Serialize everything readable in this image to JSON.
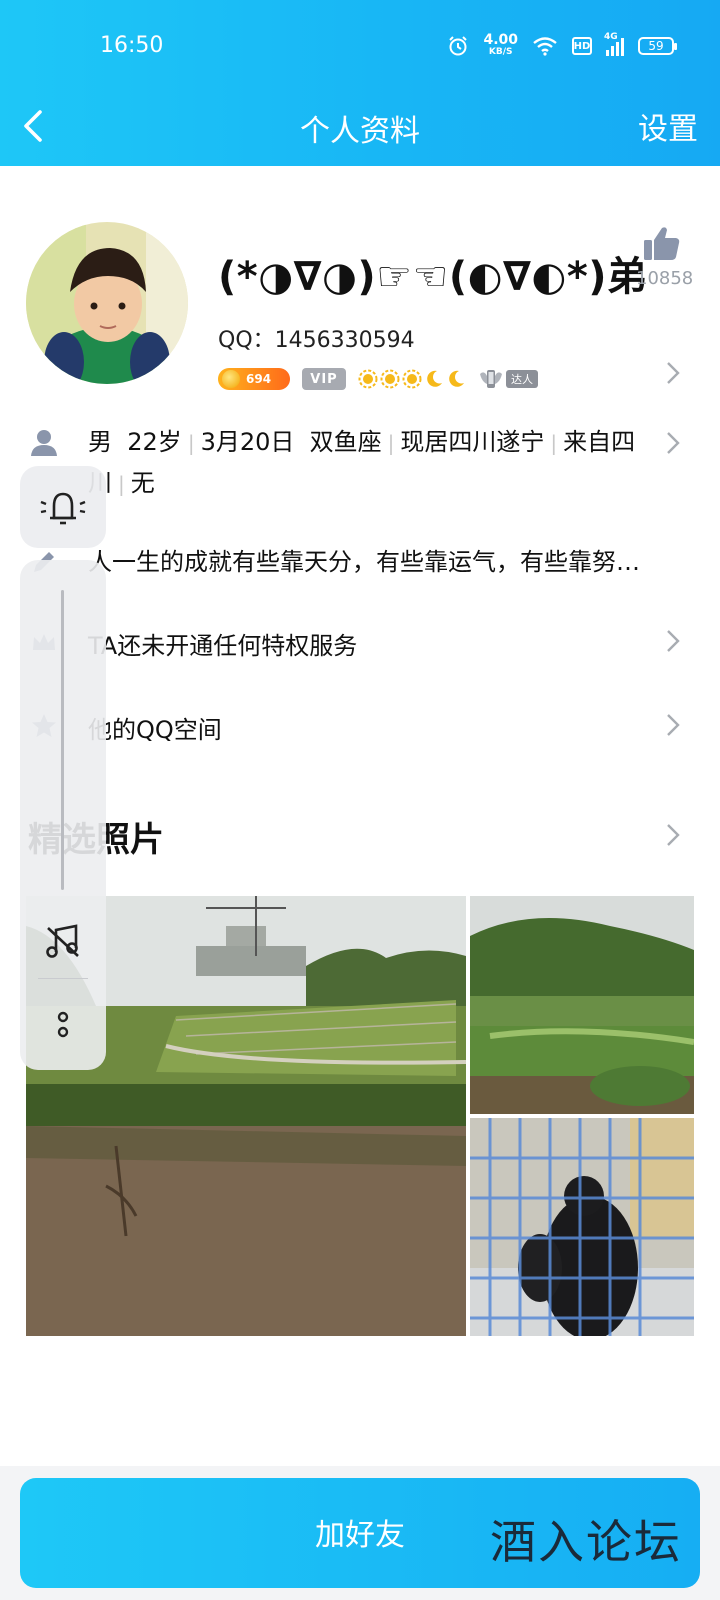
{
  "status_bar": {
    "time": "16:50",
    "speed_value": "4.00",
    "speed_unit": "KB/S",
    "hd": "HD",
    "network": "4G",
    "battery": "59"
  },
  "nav": {
    "back_icon": "chevron-left-icon",
    "title": "个人资料",
    "settings": "设置"
  },
  "profile": {
    "nickname": "(*◑∇◑)☞☜(◐∇◐*)弟",
    "qq_label": "QQ：",
    "qq_number": "1456330594",
    "level_value": "694",
    "vip_label": "VIP",
    "daren_label": "达人",
    "like_count": "10858"
  },
  "info": {
    "gender": "男",
    "age": "22岁",
    "birthday": "3月20日",
    "zodiac": "双鱼座",
    "location": "现居四川遂宁",
    "hometown": "来自四川",
    "extra": "无"
  },
  "signature": "人一生的成就有些靠天分，有些靠运气，有些靠努…",
  "privilege": "TA还未开通任何特权服务",
  "qzone": "他的QQ空间",
  "photos_title": "精选照片",
  "bottom": {
    "add_friend": "加好友",
    "watermark": "酒入论坛"
  },
  "colors": {
    "header": "#18b6f5",
    "button": "#1ec8f7"
  }
}
